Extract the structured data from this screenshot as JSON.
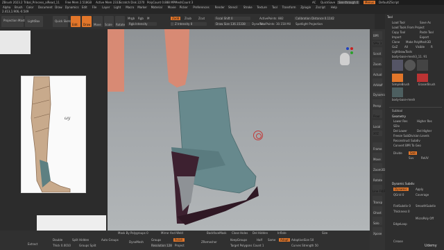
{
  "titlebar": {
    "app": "ZBrush 2023.2",
    "doc": "Tribal_Princess_alRead_11",
    "free_mem": "Free Mem 2.518GB",
    "active_mem": "Active Mem 2333",
    "scratch": "Scratch Disk 2270",
    "polycount": "PolyCount 0.888 MP",
    "meshcount": "MeshCount 3",
    "ac": "AC",
    "quicksave": "QuickSave",
    "seethrough": "See-through 0",
    "menus": "Menus",
    "defaultscript": "DefaultZScript"
  },
  "menubar": {
    "items": [
      "Alpha",
      "Brush",
      "Color",
      "Document",
      "Draw",
      "Dynamics",
      "Edit",
      "File",
      "Layer",
      "Light",
      "Macro",
      "Marker",
      "Material",
      "Movie",
      "Picker",
      "Preferences",
      "Render",
      "Stencil",
      "Stroke",
      "Texture",
      "Tool",
      "Transform",
      "Zplugin",
      "Zscript",
      "Help"
    ]
  },
  "coords": "2.413,1.906,-0.549",
  "toptool": {
    "projection_master": "Projection Master",
    "lightbox": "LightBox",
    "quick_sketch": "Quick Sketch",
    "edit": "Edit",
    "draw": "Draw",
    "move": "Move",
    "scale": "Scale",
    "rotate": "Rotate",
    "mrgb": "Mrgb",
    "rgb": "Rgb",
    "m": "M",
    "zadd": "Zadd",
    "zsub": "Zsub",
    "zcut": "Zcut",
    "rgb_intensity": "Rgb Intensity",
    "z_intensity": "Z Intensity 0",
    "focal_shift": "Focal Shift 0",
    "draw_size": "Draw Size 136.15338",
    "dynamic": "Dynamic",
    "active_points": "ActivePoints: 882",
    "total_points": "TotalPoints: 30.158 Mil",
    "calibration": "Calibration Distance 0.1142",
    "spotlight": "Spotlight Projection"
  },
  "shelf": [
    "BPR",
    "SPix 3",
    "Scroll",
    "Zoom",
    "Actual",
    "AAHalf",
    "Dynamic",
    "Persp",
    "Floor",
    "Local",
    "XYZ",
    "Frame",
    "Move",
    "Zoom3D",
    "Rotate",
    "Line Fill PolyF",
    "Transp",
    "Ghost",
    "Solo",
    "Xpose"
  ],
  "rightpanel": {
    "header": "Tool",
    "rows": [
      [
        "Load Tool",
        "Save As"
      ],
      [
        "Load Tools From Project",
        ""
      ],
      [
        "Copy Tool",
        "Paste Tool"
      ],
      [
        "Import",
        "Export"
      ],
      [
        "Clone",
        "Make PolyMesh3D"
      ],
      [
        "GoZ",
        "All",
        "Visible",
        "R"
      ],
      [
        "Lightbox▸Tools",
        ""
      ]
    ],
    "current_tool": "body-base-mesh3_11. 91",
    "thumbs": [
      "body-base-mesh",
      "PM3D_Sphere3D",
      "AlphaBrush",
      "SimpleBrush",
      "EraserBrush",
      "body-base-mesh"
    ],
    "subtool": "Subtool",
    "geometry": "Geometry",
    "lower_res": "Lower Res",
    "higher_res": "Higher Res",
    "sdiv": "SDiv",
    "del_lower": "Del Lower",
    "del_higher": "Del Higher",
    "freeze_subdiv": "Freeze SubDivision Levels",
    "reconstruct": "Reconstruct Subdiv",
    "convert_bpr": "Convert BPR To Geo",
    "divide": "Divide",
    "smt": "Smt",
    "suv": "Suv",
    "reuv": "ReUV",
    "dynamic_subdiv": "Dynamic Subdiv",
    "dynamic": "Dynamic",
    "apply": "Apply",
    "qgrid": "QGrid 0",
    "coverage": "Coverage",
    "flatsubdiv": "FlatSubdiv 0",
    "smoothsubdiv": "SmoothSubdiv",
    "thickness": "Thickness 0",
    "edgeloop": "EdgeLoop",
    "microploy": "MicroPoly Off",
    "crease": "Crease"
  },
  "bottombar": {
    "mask_polygroups": "Mask By Polygroups 0",
    "mirror_weld": "Mirror And Weld",
    "backface_mask": "BackfaceMask",
    "close_holes": "Close Holes",
    "del_hidden": "Del Hidden",
    "inflate": "Inflate",
    "size": "Size",
    "extract": "Extract",
    "double": "Double",
    "split_hidden": "Split Hidden",
    "auto_groups": "Auto Groups",
    "dynamesh": "DynaMesh",
    "groups": "Groups",
    "polish": "Polish",
    "zremesher": "ZRemesher",
    "polygroups_it": "PolyGroupIt",
    "keep_groups": "KeepGroups",
    "half": "Half",
    "same": "Same",
    "adapt": "Adapt",
    "adaptive_size": "AdaptiveSize 50",
    "curves_strength": "Curves Strength 50",
    "target_polygons": "Target Polygons Count 1",
    "thick": "Thick 0.0010",
    "groups_split": "Groups Split",
    "resolution": "Resolution 128",
    "project": "Project",
    "udemy": "Udemy"
  },
  "colors": {
    "accent": "#e2762a",
    "boot": "#67898d",
    "heel": "#3d2130",
    "leg": "#d88a74"
  },
  "icons": {
    "gizmo": "gizmo-icon",
    "head": "navigation-head-icon",
    "cursor": "brush-cursor-icon"
  }
}
